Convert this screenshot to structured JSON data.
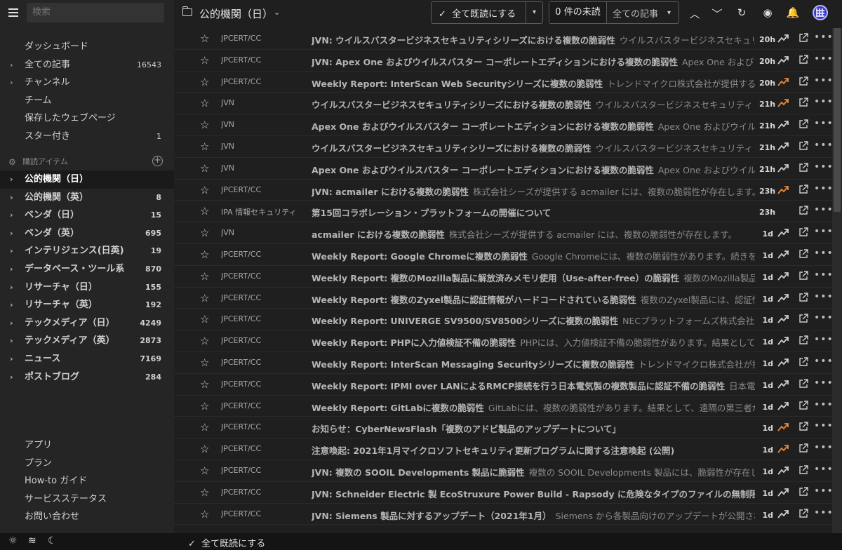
{
  "search": {
    "placeholder": "検索"
  },
  "sidebar": {
    "top_items": [
      {
        "label": "ダッシュボード",
        "count": ""
      },
      {
        "label": "全ての記事",
        "count": "16543"
      },
      {
        "label": "チャンネル",
        "count": ""
      },
      {
        "label": "チーム",
        "count": ""
      },
      {
        "label": "保存したウェブページ",
        "count": ""
      },
      {
        "label": "スター付き",
        "count": "1"
      }
    ],
    "section_label": "購読アイテム",
    "feeds": [
      {
        "label": "公的機関（日）",
        "count": ""
      },
      {
        "label": "公的機関（英）",
        "count": "8"
      },
      {
        "label": "ベンダ（日）",
        "count": "15"
      },
      {
        "label": "ベンダ（英）",
        "count": "695"
      },
      {
        "label": "インテリジェンス(日英)",
        "count": "19"
      },
      {
        "label": "データベース・ツール系",
        "count": "870"
      },
      {
        "label": "リサーチャ（日）",
        "count": "155"
      },
      {
        "label": "リサーチャ（英）",
        "count": "192"
      },
      {
        "label": "テックメディア（日）",
        "count": "4249"
      },
      {
        "label": "テックメディア（英）",
        "count": "2873"
      },
      {
        "label": "ニュース",
        "count": "7169"
      },
      {
        "label": "ポストブログ",
        "count": "284"
      }
    ],
    "bottom_items": [
      {
        "label": "アプリ"
      },
      {
        "label": "プラン"
      },
      {
        "label": "How-to ガイド"
      },
      {
        "label": "サービスステータス"
      },
      {
        "label": "お問い合わせ"
      }
    ]
  },
  "header": {
    "title": "公的機関（日）",
    "mark_read_label": "全て既読にする",
    "unread_label": "0 件の未読",
    "all_label": "全ての記事"
  },
  "footer": {
    "mark_read_label": "全て既読にする"
  },
  "colors": {
    "trend_hot": "#e8883a",
    "trend_normal": "#cccccc"
  },
  "articles": [
    {
      "source": "JPCERT/CC",
      "title": "JVN: ウイルスバスタービジネスセキュリティシリーズにおける複数の脆弱性",
      "desc": "ウイルスバスタービジネスセキュリティ",
      "age": "20h",
      "hot": false
    },
    {
      "source": "JPCERT/CC",
      "title": "JVN: Apex One およびウイルスバスター コーポレートエディションにおける複数の脆弱性",
      "desc": "Apex One および",
      "age": "20h",
      "hot": false
    },
    {
      "source": "JPCERT/CC",
      "title": "Weekly Report: InterScan Web Securityシリーズに複数の脆弱性",
      "desc": "トレンドマイクロ株式会社が提供するInterSc",
      "age": "20h",
      "hot": true
    },
    {
      "source": "JVN",
      "title": "ウイルスバスタービジネスセキュリティシリーズにおける複数の脆弱性",
      "desc": "ウイルスバスタービジネスセキュリティ",
      "age": "21h",
      "hot": true
    },
    {
      "source": "JVN",
      "title": "Apex One およびウイルスバスター コーポレートエディションにおける複数の脆弱性",
      "desc": "Apex One およびウイル",
      "age": "21h",
      "hot": false
    },
    {
      "source": "JVN",
      "title": "ウイルスバスタービジネスセキュリティシリーズにおける複数の脆弱性",
      "desc": "ウイルスバスタービジネスセキュリティ",
      "age": "21h",
      "hot": false
    },
    {
      "source": "JVN",
      "title": "Apex One およびウイルスバスター コーポレートエディションにおける複数の脆弱性",
      "desc": "Apex One およびウイル",
      "age": "21h",
      "hot": false
    },
    {
      "source": "JPCERT/CC",
      "title": "JVN: acmailer における複数の脆弱性",
      "desc": "株式会社シーズが提供する acmailer には、複数の脆弱性が存在します。",
      "age": "23h",
      "hot": true
    },
    {
      "source": "IPA 情報セキュリティ",
      "title": "第15回コラボレーション・プラットフォームの開催について",
      "desc": "",
      "age": "23h",
      "hot": false,
      "notrend": true
    },
    {
      "source": "JVN",
      "title": "acmailer における複数の脆弱性",
      "desc": "株式会社シーズが提供する acmailer には、複数の脆弱性が存在します。",
      "age": "1d",
      "hot": false
    },
    {
      "source": "JPCERT/CC",
      "title": "Weekly Report: Google Chromeに複数の脆弱性",
      "desc": "Google Chromeには、複数の脆弱性があります。続きを読む",
      "age": "1d",
      "hot": false
    },
    {
      "source": "JPCERT/CC",
      "title": "Weekly Report: 複数のMozilla製品に解放済みメモリ使用（Use-after-free）の脆弱性",
      "desc": "複数のMozilla製品には、",
      "age": "1d",
      "hot": false
    },
    {
      "source": "JPCERT/CC",
      "title": "Weekly Report: 複数のZyxel製品に認証情報がハードコードされている脆弱性",
      "desc": "複数のZyxel製品には、認証情報",
      "age": "1d",
      "hot": false
    },
    {
      "source": "JPCERT/CC",
      "title": "Weekly Report: UNIVERGE SV9500/SV8500シリーズに複数の脆弱性",
      "desc": "NECプラットフォームズ株式会社が提供す",
      "age": "1d",
      "hot": false
    },
    {
      "source": "JPCERT/CC",
      "title": "Weekly Report: PHPに入力値検証不備の脆弱性",
      "desc": "PHPには、入力値検証不備の脆弱性があります。結果として、",
      "age": "1d",
      "hot": false
    },
    {
      "source": "JPCERT/CC",
      "title": "Weekly Report: InterScan Messaging Securityシリーズに複数の脆弱性",
      "desc": "トレンドマイクロ株式会社が提供する",
      "age": "1d",
      "hot": false
    },
    {
      "source": "JPCERT/CC",
      "title": "Weekly Report: IPMI over LANによるRMCP接続を行う日本電気製の複数製品に認証不備の脆弱性",
      "desc": "日本電気製の",
      "age": "1d",
      "hot": false
    },
    {
      "source": "JPCERT/CC",
      "title": "Weekly Report: GitLabに複数の脆弱性",
      "desc": "GitLabには、複数の脆弱性があります。結果として、遠隔の第三者がサ",
      "age": "1d",
      "hot": false
    },
    {
      "source": "JPCERT/CC",
      "title": "お知らせ：CyberNewsFlash「複数のアドビ製品のアップデートについて」",
      "desc": "",
      "age": "1d",
      "hot": true
    },
    {
      "source": "JPCERT/CC",
      "title": "注意喚起: 2021年1月マイクロソフトセキュリティ更新プログラムに関する注意喚起 (公開)",
      "desc": "",
      "age": "1d",
      "hot": true
    },
    {
      "source": "JPCERT/CC",
      "title": "JVN: 複数の SOOIL Developments 製品に脆弱性",
      "desc": "複数の SOOIL Developments 製品には、脆弱性が存在します。",
      "age": "1d",
      "hot": false
    },
    {
      "source": "JPCERT/CC",
      "title": "JVN: Schneider Electric 製 EcoStruxure Power Build - Rapsody に危険なタイプのファイルの無制限アップロー",
      "desc": "",
      "age": "1d",
      "hot": false
    },
    {
      "source": "JPCERT/CC",
      "title": "JVN: Siemens 製品に対するアップデート（2021年1月）",
      "desc": "Siemens から各製品向けのアップデートが公開され",
      "age": "1d",
      "hot": false
    }
  ]
}
